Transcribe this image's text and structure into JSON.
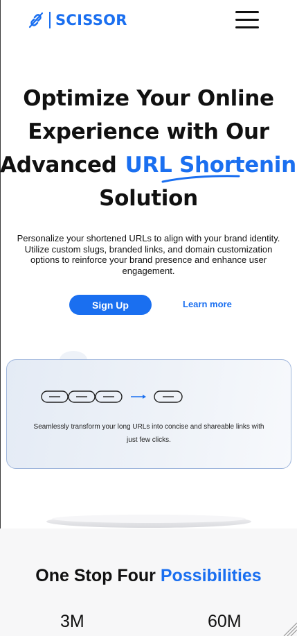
{
  "header": {
    "brand": "SCISSOR",
    "logo_icon": "chain-link-slash-icon",
    "menu_icon": "hamburger-menu-icon"
  },
  "hero": {
    "title_line1": "Optimize Your Online",
    "title_line2": "Experience with Our",
    "title_line3_plain": "Advanced",
    "title_line3_highlight": "URL Shortening",
    "title_line4": "Solution",
    "description": "Personalize your shortened URLs to align with your brand identity. Utilize custom slugs, branded links, and domain customization options to reinforce your brand presence and enhance user engagement.",
    "signup_label": "Sign Up",
    "learn_more_label": "Learn more"
  },
  "card": {
    "text": "Seamlessly transform your long URLs into concise and shareable links with just few clicks.",
    "illustration": "long-chain-to-short-chain-icon"
  },
  "possibilities": {
    "heading_plain": "One Stop Four",
    "heading_accent": "Possibilities"
  },
  "stats": [
    {
      "value": "3M"
    },
    {
      "value": "60M"
    }
  ],
  "colors": {
    "brand": "#1a6ff0",
    "text": "#111111",
    "card_border": "#9fb6dc"
  }
}
